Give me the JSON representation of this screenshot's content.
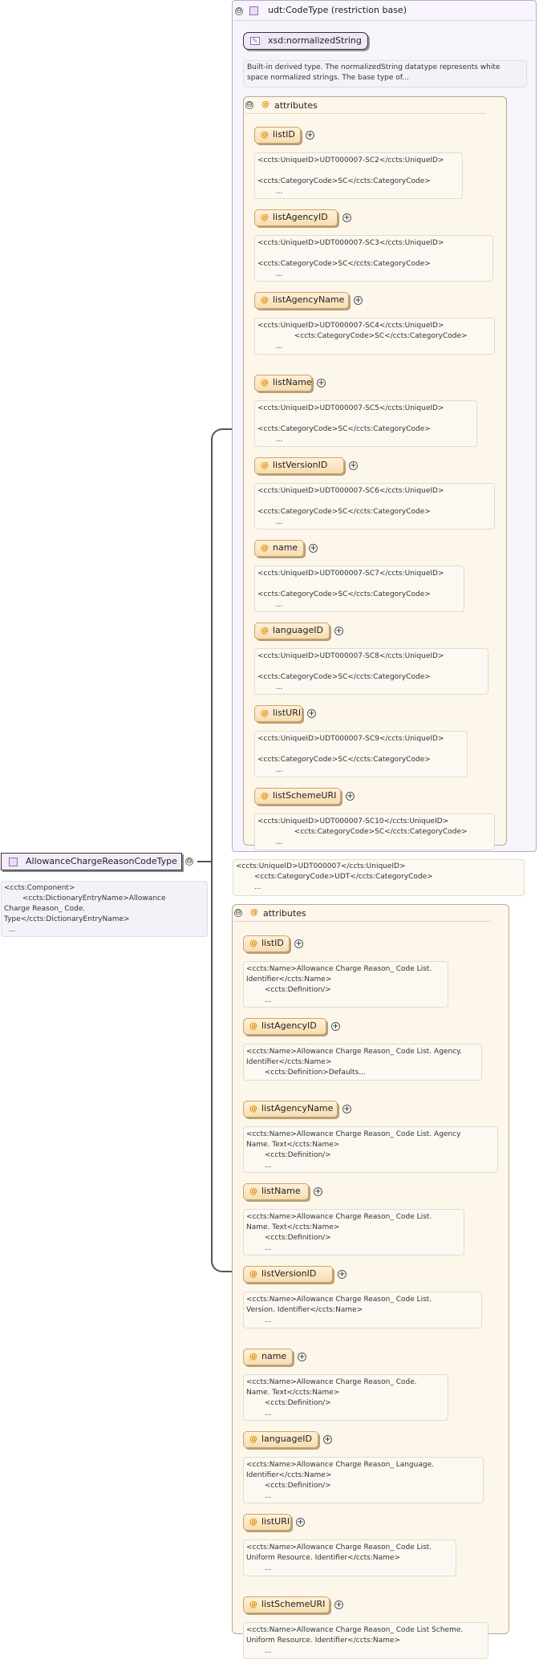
{
  "root": {
    "name": "AllowanceChargeReasonCodeType",
    "doc": [
      "<ccts:Component>",
      "        <ccts:DictionaryEntryName>Allowance",
      "Charge Reason_ Code.",
      "Type</ccts:DictionaryEntryName>",
      "  ..."
    ]
  },
  "base": {
    "title": "udt:CodeType (restriction base)",
    "simple_type": "xsd:normalizedString",
    "simple_doc": [
      "Built-in derived type. The normalizedString datatype represents white",
      "space normalized strings. The base type of..."
    ],
    "group_label": "attributes",
    "attributes": [
      {
        "name": "listID",
        "doc": [
          "<ccts:UniqueID>UDT000007-SC2</ccts:UniqueID>",
          "",
          "<ccts:CategoryCode>SC</ccts:CategoryCode>",
          "        ..."
        ]
      },
      {
        "name": "listAgencyID",
        "doc": [
          "<ccts:UniqueID>UDT000007-SC3</ccts:UniqueID>",
          "",
          "<ccts:CategoryCode>SC</ccts:CategoryCode>",
          "        ..."
        ]
      },
      {
        "name": "listAgencyName",
        "doc": [
          "<ccts:UniqueID>UDT000007-SC4</ccts:UniqueID>",
          "                <ccts:CategoryCode>SC</ccts:CategoryCode>",
          "        ..."
        ]
      },
      {
        "name": "listName",
        "doc": [
          "<ccts:UniqueID>UDT000007-SC5</ccts:UniqueID>",
          "",
          "<ccts:CategoryCode>SC</ccts:CategoryCode>",
          "        ..."
        ]
      },
      {
        "name": "listVersionID",
        "doc": [
          "<ccts:UniqueID>UDT000007-SC6</ccts:UniqueID>",
          "",
          "<ccts:CategoryCode>SC</ccts:CategoryCode>",
          "        ..."
        ]
      },
      {
        "name": "name",
        "doc": [
          "<ccts:UniqueID>UDT000007-SC7</ccts:UniqueID>",
          "",
          "<ccts:CategoryCode>SC</ccts:CategoryCode>",
          "        ..."
        ]
      },
      {
        "name": "languageID",
        "doc": [
          "<ccts:UniqueID>UDT000007-SC8</ccts:UniqueID>",
          "",
          "<ccts:CategoryCode>SC</ccts:CategoryCode>",
          "        ..."
        ]
      },
      {
        "name": "listURI",
        "doc": [
          "<ccts:UniqueID>UDT000007-SC9</ccts:UniqueID>",
          "",
          "<ccts:CategoryCode>SC</ccts:CategoryCode>",
          "        ..."
        ]
      },
      {
        "name": "listSchemeURI",
        "doc": [
          "<ccts:UniqueID>UDT000007-SC10</ccts:UniqueID>",
          "                <ccts:CategoryCode>SC</ccts:CategoryCode>",
          "        ..."
        ]
      }
    ],
    "base_doc": [
      "<ccts:UniqueID>UDT000007</ccts:UniqueID>",
      "        <ccts:CategoryCode>UDT</ccts:CategoryCode>",
      "        ..."
    ]
  },
  "derived": {
    "group_label": "attributes",
    "attributes": [
      {
        "name": "listID",
        "doc": [
          "<ccts:Name>Allowance Charge Reason_ Code List.",
          "Identifier</ccts:Name>",
          "        <ccts:Definition/>",
          "        ..."
        ]
      },
      {
        "name": "listAgencyID",
        "doc": [
          "<ccts:Name>Allowance Charge Reason_ Code List. Agency.",
          "Identifier</ccts:Name>",
          "        <ccts:Definition>Defaults..."
        ]
      },
      {
        "name": "listAgencyName",
        "doc": [
          "<ccts:Name>Allowance Charge Reason_ Code List. Agency",
          "Name. Text</ccts:Name>",
          "        <ccts:Definition/>",
          "        ..."
        ]
      },
      {
        "name": "listName",
        "doc": [
          "<ccts:Name>Allowance Charge Reason_ Code List.",
          "Name. Text</ccts:Name>",
          "        <ccts:Definition/>",
          "        ..."
        ]
      },
      {
        "name": "listVersionID",
        "doc": [
          "<ccts:Name>Allowance Charge Reason_ Code List.",
          "Version. Identifier</ccts:Name>",
          "        ..."
        ]
      },
      {
        "name": "name",
        "doc": [
          "<ccts:Name>Allowance Charge Reason_ Code.",
          "Name. Text</ccts:Name>",
          "        <ccts:Definition/>",
          "        ..."
        ]
      },
      {
        "name": "languageID",
        "doc": [
          "<ccts:Name>Allowance Charge Reason_ Language.",
          "Identifier</ccts:Name>",
          "        <ccts:Definition/>",
          "        ..."
        ]
      },
      {
        "name": "listURI",
        "doc": [
          "<ccts:Name>Allowance Charge Reason_ Code List.",
          "Uniform Resource. Identifier</ccts:Name>",
          "        ..."
        ]
      },
      {
        "name": "listSchemeURI",
        "doc": [
          "<ccts:Name>Allowance Charge Reason_ Code List Scheme.",
          "Uniform Resource. Identifier</ccts:Name>",
          "        ..."
        ]
      }
    ]
  },
  "icons": {
    "collapse": "⊖",
    "expand": "⊕",
    "attribute": "@",
    "pen": "✎"
  }
}
